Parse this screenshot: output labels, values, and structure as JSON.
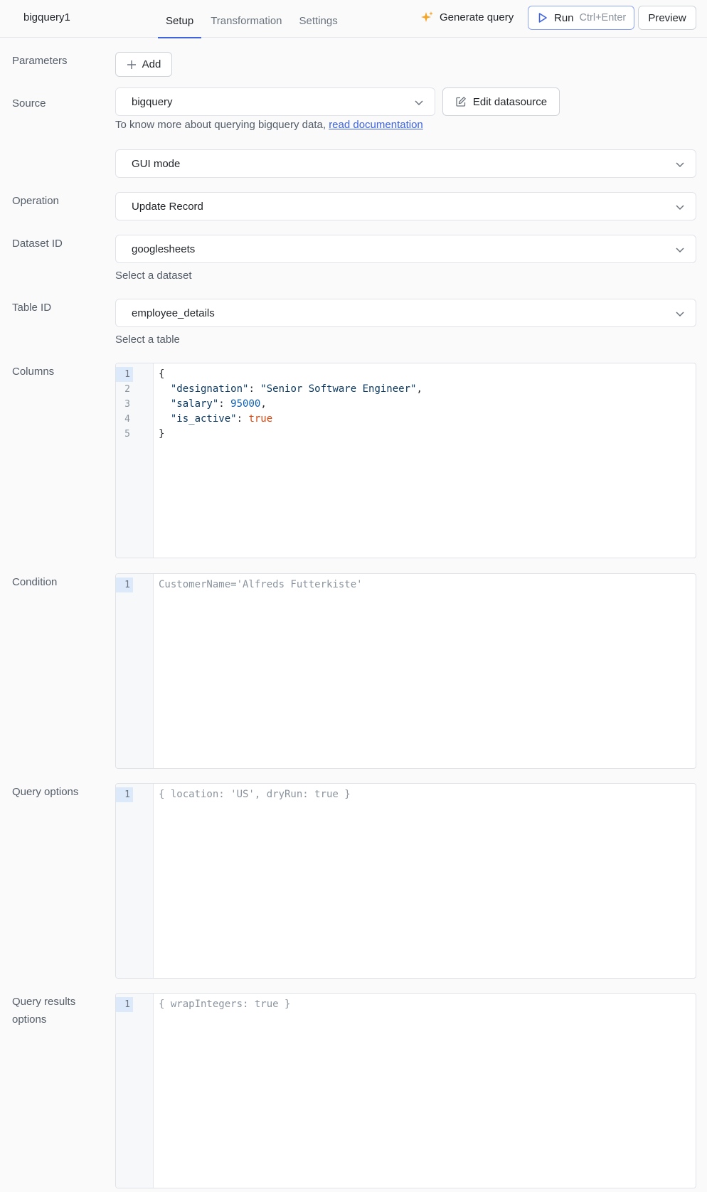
{
  "header": {
    "query_name": "bigquery1",
    "tabs": [
      {
        "label": "Setup",
        "active": true
      },
      {
        "label": "Transformation",
        "active": false
      },
      {
        "label": "Settings",
        "active": false
      }
    ],
    "generate_label": "Generate query",
    "run_label": "Run",
    "run_shortcut": "Ctrl+Enter",
    "preview_label": "Preview"
  },
  "parameters": {
    "label": "Parameters",
    "add_label": "Add"
  },
  "source": {
    "label": "Source",
    "value": "bigquery",
    "edit_label": "Edit datasource",
    "helper_prefix": "To know more about querying bigquery data, ",
    "helper_link": "read documentation"
  },
  "mode": {
    "value": "GUI mode"
  },
  "operation": {
    "label": "Operation",
    "value": "Update Record"
  },
  "dataset": {
    "label": "Dataset ID",
    "value": "googlesheets",
    "helper": "Select a dataset"
  },
  "table": {
    "label": "Table ID",
    "value": "employee_details",
    "helper": "Select a table"
  },
  "columns": {
    "label": "Columns",
    "line_numbers": [
      "1",
      "2",
      "3",
      "4",
      "5"
    ],
    "lines": [
      {
        "text": "{"
      },
      {
        "key": "\"designation\"",
        "sep": ": ",
        "value": "\"Senior Software Engineer\"",
        "end": ","
      },
      {
        "key": "\"salary\"",
        "sep": ": ",
        "value": "95000",
        "end": ","
      },
      {
        "key": "\"is_active\"",
        "sep": ": ",
        "value": "true",
        "end": ""
      },
      {
        "text": "}"
      }
    ]
  },
  "condition": {
    "label": "Condition",
    "line_number": "1",
    "placeholder": "CustomerName='Alfreds Futterkiste'"
  },
  "query_options": {
    "label": "Query options",
    "line_number": "1",
    "placeholder": "{ location: 'US', dryRun: true }"
  },
  "query_results_options": {
    "label_line1": "Query results",
    "label_line2": "options",
    "line_number": "1",
    "placeholder": "{ wrapIntegers: true }"
  },
  "colors": {
    "accent": "#3e63dd",
    "border": "#dfe3e8",
    "number": "#0d5fb3",
    "boolean": "#d9480f",
    "spark": "#f5a524"
  }
}
